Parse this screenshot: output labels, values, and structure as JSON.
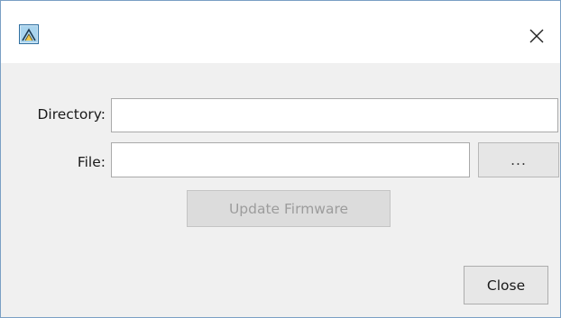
{
  "window": {
    "app_icon": "app-logo-icon",
    "close_icon": "close-icon"
  },
  "form": {
    "directory_label": "Directory:",
    "directory_value": "",
    "file_label": "File:",
    "file_value": "",
    "browse_label": "..."
  },
  "actions": {
    "update_label": "Update Firmware",
    "update_enabled": false,
    "close_label": "Close"
  },
  "colors": {
    "window_border": "#7a9fc4",
    "dialog_background": "#f0f0f0",
    "titlebar_background": "#ffffff",
    "disabled_text": "#9c9c9c"
  }
}
